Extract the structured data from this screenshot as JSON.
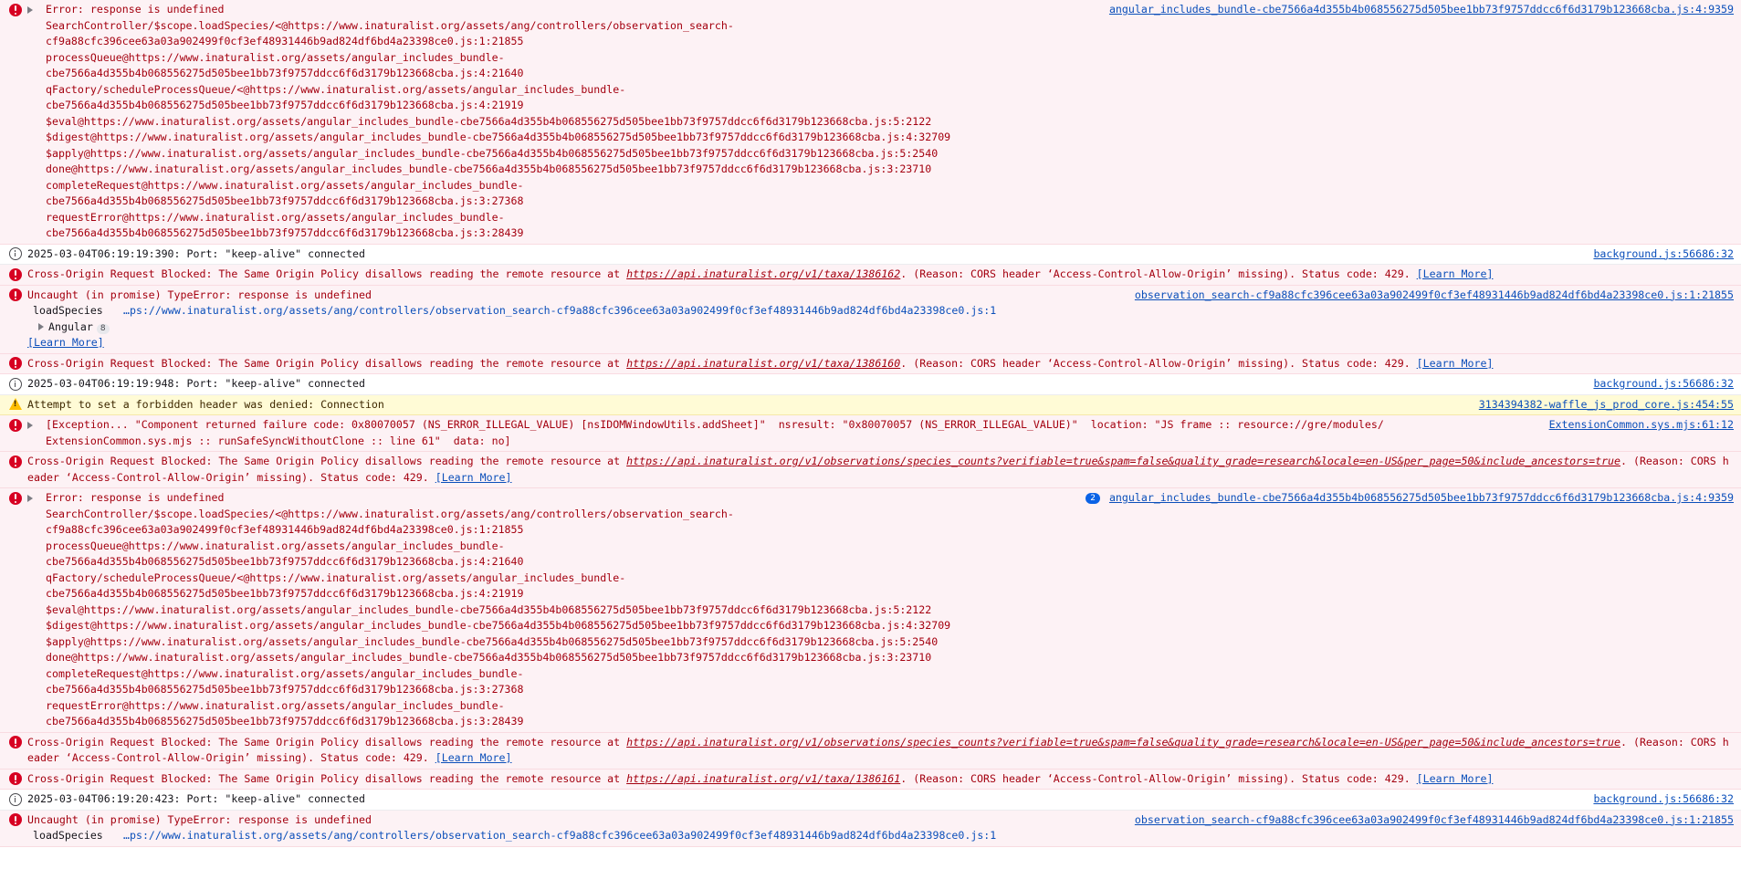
{
  "learn_more": "[Learn More]",
  "stack": {
    "header": "Error: response is undefined",
    "lines": [
      "SearchController/$scope.loadSpecies/<@https://www.inaturalist.org/assets/ang/controllers/observation_search-",
      "cf9a88cfc396cee63a03a902499f0cf3ef48931446b9ad824df6bd4a23398ce0.js:1:21855",
      "processQueue@https://www.inaturalist.org/assets/angular_includes_bundle-",
      "cbe7566a4d355b4b068556275d505bee1bb73f9757ddcc6f6d3179b123668cba.js:4:21640",
      "qFactory/scheduleProcessQueue/<@https://www.inaturalist.org/assets/angular_includes_bundle-",
      "cbe7566a4d355b4b068556275d505bee1bb73f9757ddcc6f6d3179b123668cba.js:4:21919",
      "$eval@https://www.inaturalist.org/assets/angular_includes_bundle-cbe7566a4d355b4b068556275d505bee1bb73f9757ddcc6f6d3179b123668cba.js:5:2122",
      "$digest@https://www.inaturalist.org/assets/angular_includes_bundle-cbe7566a4d355b4b068556275d505bee1bb73f9757ddcc6f6d3179b123668cba.js:4:32709",
      "$apply@https://www.inaturalist.org/assets/angular_includes_bundle-cbe7566a4d355b4b068556275d505bee1bb73f9757ddcc6f6d3179b123668cba.js:5:2540",
      "done@https://www.inaturalist.org/assets/angular_includes_bundle-cbe7566a4d355b4b068556275d505bee1bb73f9757ddcc6f6d3179b123668cba.js:3:23710",
      "completeRequest@https://www.inaturalist.org/assets/angular_includes_bundle-",
      "cbe7566a4d355b4b068556275d505bee1bb73f9757ddcc6f6d3179b123668cba.js:3:27368",
      "requestError@https://www.inaturalist.org/assets/angular_includes_bundle-",
      "cbe7566a4d355b4b068556275d505bee1bb73f9757ddcc6f6d3179b123668cba.js:3:28439"
    ],
    "source": "angular_includes_bundle-cbe7566a4d355b4b068556275d505bee1bb73f9757ddcc6f6d3179b123668cba.js:4:9359",
    "repeat_count": "2"
  },
  "keepalive": {
    "text_1": "2025-03-04T06:19:19:390: Port: \"keep-alive\" connected",
    "text_2": "2025-03-04T06:19:19:948: Port: \"keep-alive\" connected",
    "text_3": "2025-03-04T06:19:20:423: Port: \"keep-alive\" connected",
    "source": "background.js:56686:32"
  },
  "cors": {
    "prefix": "Cross-Origin Request Blocked: The Same Origin Policy disallows reading the remote resource at ",
    "suffix": ". (Reason: CORS header ‘Access-Control-Allow-Origin’ missing). Status code: 429. ",
    "url_1386162": "https://api.inaturalist.org/v1/taxa/1386162",
    "url_1386160": "https://api.inaturalist.org/v1/taxa/1386160",
    "url_1386161": "https://api.inaturalist.org/v1/taxa/1386161",
    "url_species": "https://api.inaturalist.org/v1/observations/species_counts?verifiable=true&spam=false&quality_grade=research&locale=en-US&per_page=50&include_ancestors=true"
  },
  "uncaught": {
    "text": "Uncaught (in promise) TypeError: response is undefined",
    "source": "observation_search-cf9a88cfc396cee63a03a902499f0cf3ef48931446b9ad824df6bd4a23398ce0.js:1:21855",
    "frame_fn": "loadSpecies",
    "frame_loc": "…ps://www.inaturalist.org/assets/ang/controllers/observation_search-cf9a88cfc396cee63a03a902499f0cf3ef48931446b9ad824df6bd4a23398ce0.js:1",
    "group_label": "Angular",
    "group_count": "8"
  },
  "warning": {
    "text": "Attempt to set a forbidden header was denied: Connection",
    "source": "3134394382-waffle_js_prod_core.js:454:55"
  },
  "exception": {
    "line1": "[Exception... \"Component returned failure code: 0x80070057 (NS_ERROR_ILLEGAL_VALUE) [nsIDOMWindowUtils.addSheet]\"  nsresult: \"0x80070057 (NS_ERROR_ILLEGAL_VALUE)\"  location: \"JS frame :: resource://gre/modules/",
    "line2": "ExtensionCommon.sys.mjs :: runSafeSyncWithoutClone :: line 61\"  data: no]",
    "source": "ExtensionCommon.sys.mjs:61:12"
  },
  "colors": {
    "error_bg": "#fdf2f5",
    "error_text": "#a4000f",
    "warn_bg": "#fffbd6",
    "link": "#0b4fba",
    "badge": "#0b63e6"
  }
}
